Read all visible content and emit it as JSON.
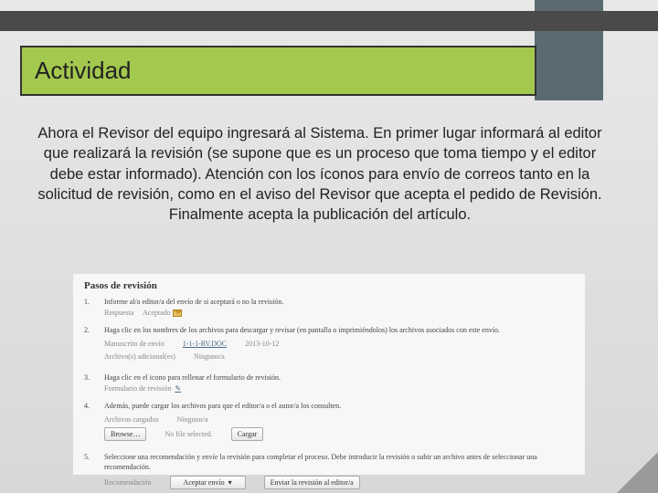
{
  "title": "Actividad",
  "body": "Ahora el Revisor del equipo ingresará al Sistema. En primer lugar informará al editor que realizará la revisión (se supone que es un proceso que toma tiempo y el editor debe estar informado). Atención con los íconos para envío de correos tanto en la solicitud de revisión, como en el aviso del Revisor que acepta el pedido de Revisión. Finalmente acepta la publicación del artículo.",
  "panel": {
    "heading": "Pasos de revisión",
    "steps": {
      "s1": {
        "num": "1.",
        "text": "Informe al/a editor/a del envío de si aceptará o no la revisión.",
        "respuesta_label": "Respuesta",
        "aceptar": "Aceptado"
      },
      "s2": {
        "num": "2.",
        "text": "Haga clic en los nombres de los archivos para descargar y revisar (en pantalla o imprimiéndolos) los archivos asociados con este envío.",
        "manuscrito": "Manuscrito de envío",
        "manuscrito_link": "1-1-1-RV.DOC",
        "manuscrito_date": "2013-10-12",
        "archivos": "Archivo(s) adicional(es)",
        "ninguno": "Ninguno/a"
      },
      "s3": {
        "num": "3.",
        "text": "Haga clic en el icono para rellenar el formulario de revisión.",
        "formulario": "Formulario de revisión"
      },
      "s4": {
        "num": "4.",
        "text": "Además, puede cargar los archivos para que el editor/a o el autor/a los consulten.",
        "archivos_cargados": "Archivos cargados",
        "ninguno": "Ninguno/a",
        "browse": "Browse…",
        "nofile": "No file selected.",
        "cargar": "Cargar"
      },
      "s5": {
        "num": "5.",
        "text": "Seleccione una recomendación y envíe la revisión para completar el proceso. Debe introducir la revisión o subir un archivo antes de seleccionar una recomendación.",
        "reco": "Recomendación",
        "select": "Aceptar envío",
        "enviar": "Enviar la revisión al editor/a"
      }
    }
  }
}
